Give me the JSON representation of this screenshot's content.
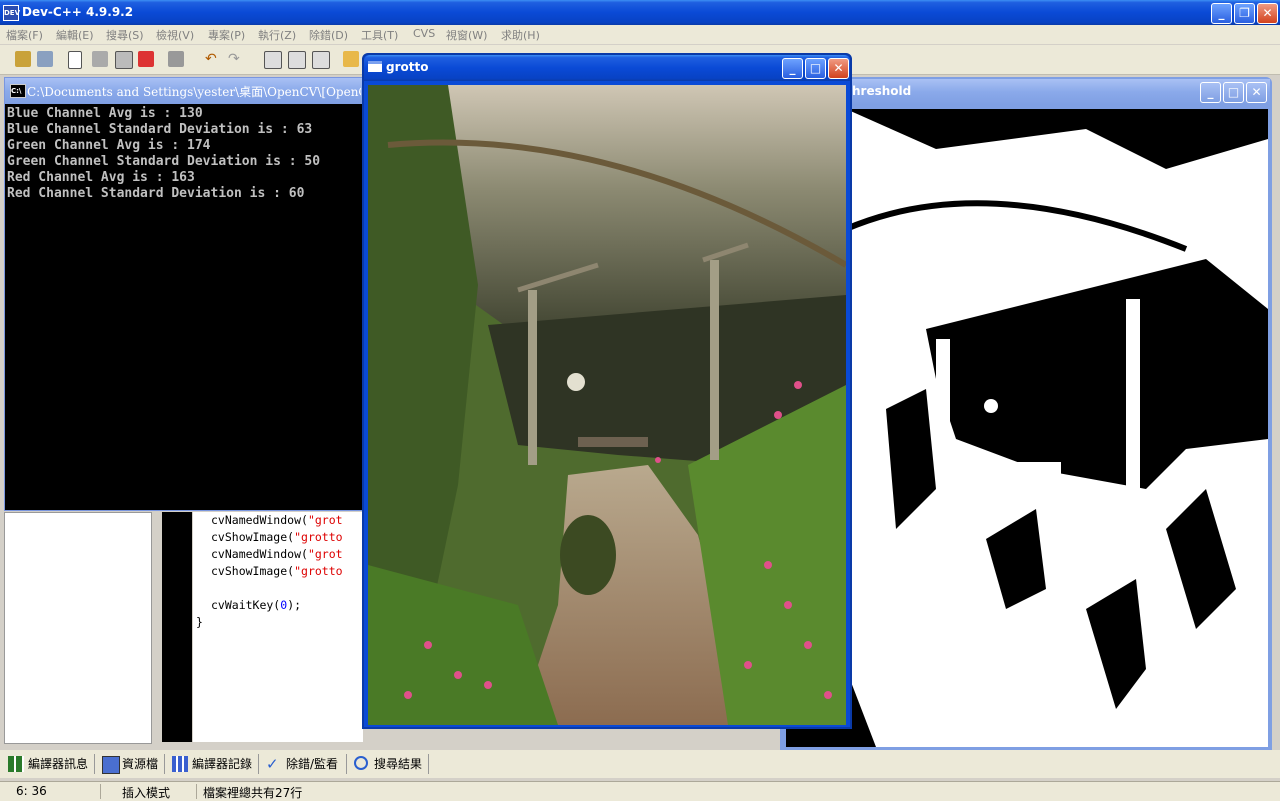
{
  "app": {
    "title": "Dev-C++ 4.9.9.2",
    "icon": "devcpp-icon",
    "window_controls": [
      "minimize",
      "restore",
      "close"
    ]
  },
  "menu": [
    "檔案(F)",
    "編輯(E)",
    "搜尋(S)",
    "檢視(V)",
    "專案(P)",
    "執行(Z)",
    "除錯(D)",
    "工具(T)",
    "CVS",
    "視窗(W)",
    "求助(H)"
  ],
  "console": {
    "title": "C:\\Documents and Settings\\yester\\桌面\\OpenCV\\[OpenCV]",
    "lines": [
      "Blue Channel Avg is : 130",
      "Blue Channel Standard Deviation is : 63",
      "Green Channel Avg is : 174",
      "Green Channel Standard Deviation is : 50",
      "Red Channel Avg is : 163",
      "Red Channel Standard Deviation is : 60"
    ]
  },
  "editor": {
    "code_lines": [
      {
        "fn": "cvNamedWindow(",
        "str": "\"grot"
      },
      {
        "fn": "cvShowImage(",
        "str": "\"grotto"
      },
      {
        "fn": "cvNamedWindow(",
        "str": "\"grot"
      },
      {
        "fn": "cvShowImage(",
        "str": "\"grotto"
      },
      {
        "fn": "",
        "str": ""
      },
      {
        "fn": "cvWaitKey(",
        "num": "0",
        "end": ");"
      },
      {
        "fn": "}",
        "str": ""
      }
    ]
  },
  "grotto_window": {
    "title": "grotto"
  },
  "threshold_window": {
    "title": "hreshold"
  },
  "bottom_tabs": [
    {
      "label": "編譯器訊息",
      "icon": "grid-icon"
    },
    {
      "label": "資源檔",
      "icon": "resource-icon"
    },
    {
      "label": "編譯器記錄",
      "icon": "chart-icon"
    },
    {
      "label": "除錯/監看",
      "icon": "check-icon"
    },
    {
      "label": "搜尋結果",
      "icon": "search-icon"
    }
  ],
  "status": {
    "position": "6: 36",
    "mode": "插入模式",
    "info": "檔案裡總共有27行"
  }
}
